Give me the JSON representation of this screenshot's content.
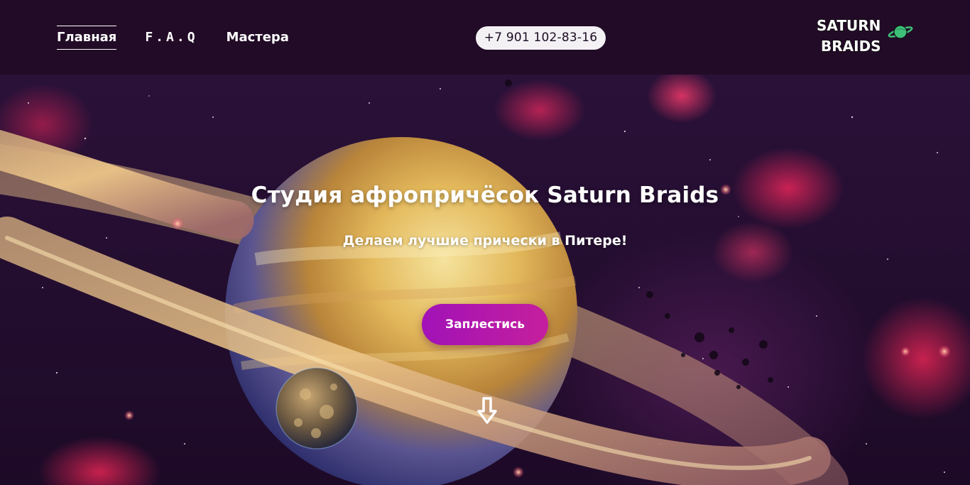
{
  "nav": {
    "items": [
      {
        "label": "Главная",
        "active": true
      },
      {
        "label": "F.A.Q",
        "active": false
      },
      {
        "label": "Мастера",
        "active": false
      }
    ]
  },
  "contact": {
    "phone": "+7 901 102-83-16"
  },
  "logo": {
    "line1": "SATURN",
    "line2": "BRAIDS"
  },
  "hero": {
    "title": "Студия афропричёсок Saturn Braids",
    "subtitle": "Делаем лучшие прически в Питере!",
    "cta_label": "Заплестись"
  },
  "icons": {
    "logo_planet": "planet-icon",
    "scroll": "arrow-down-icon"
  },
  "colors": {
    "header_bg": "#220b27",
    "accent_gradient_start": "#a112b7",
    "accent_gradient_end": "#c51f9d",
    "phone_bg": "#f3f1f4",
    "logo_planet": "#3ec07a"
  }
}
